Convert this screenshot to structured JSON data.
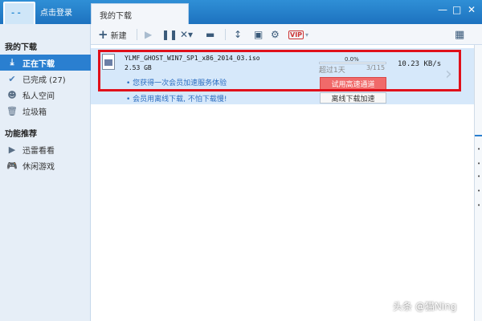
{
  "header": {
    "login_text": "点击登录",
    "tab_label": "我的下载",
    "minimize_glyph": "—",
    "maximize_glyph": "□",
    "close_glyph": "✕"
  },
  "sidebar": {
    "section1": "我的下载",
    "items": [
      {
        "label": "正在下载",
        "icon": "download-icon"
      },
      {
        "label": "已完成 (27)",
        "icon": "check-icon"
      },
      {
        "label": "私人空间",
        "icon": "person-icon"
      },
      {
        "label": "垃圾箱",
        "icon": "trash-icon"
      }
    ],
    "section2": "功能推荐",
    "features": [
      {
        "label": "迅雷看看",
        "icon": "play-icon"
      },
      {
        "label": "休闲游戏",
        "icon": "gamepad-icon"
      }
    ]
  },
  "toolbar": {
    "new_label": "新建",
    "vip_label": "VIP"
  },
  "task": {
    "filename": "YLMF_GHOST_WIN7_SP1_x86_2014_03.iso",
    "size": "2.53 GB",
    "progress_text": "0.0%",
    "progress": 0.0,
    "time_left": "超过1天",
    "pieces": "3/115",
    "speed": "10.23 KB/s",
    "promo1": "• 您获得一次会员加速服务体验",
    "promo2": "• 会员用离线下载, 不怕下载慢!",
    "trial_button": "试用高速通道",
    "offline_button": "离线下载加速"
  },
  "watermark": "头条 @猫Ning",
  "colors": {
    "accent": "#2a7fd0",
    "highlight_border": "#e0101a",
    "trial_button": "#f06a6a"
  }
}
